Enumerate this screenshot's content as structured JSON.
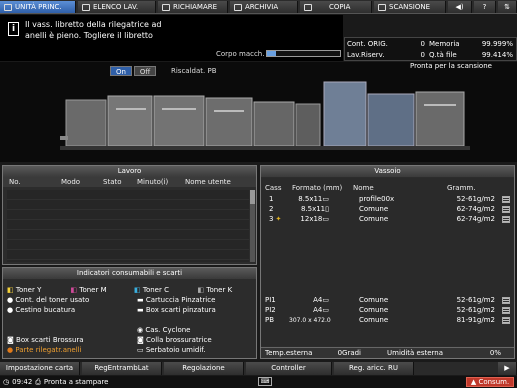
{
  "tabs": [
    {
      "label": "UNITÀ PRINC.",
      "icon": "printer-icon"
    },
    {
      "label": "ELENCO LAV.",
      "icon": "job-list-icon"
    },
    {
      "label": "RICHIAMARE",
      "icon": "recall-icon"
    },
    {
      "label": "ARCHIVIA",
      "icon": "store-icon"
    },
    {
      "label": "COPIA",
      "icon": "copy-icon"
    },
    {
      "label": "SCANSIONE",
      "icon": "scan-icon"
    }
  ],
  "message": {
    "line1": "Il vass. libretto della rilegatrice ad",
    "line2": "anelli è pieno. Togliere il libretto"
  },
  "body_label": "Corpo macch.",
  "counters": {
    "cont_orig_label": "Cont. ORIG.",
    "cont_orig": "0",
    "memoria_label": "Memoria",
    "memoria": "99.999%",
    "lav_riserv_label": "Lav.Riserv.",
    "lav_riserv": "0",
    "qta_file_label": "Q.tà file",
    "qta_file": "99.414%"
  },
  "toggle": {
    "on": "On",
    "off": "Off",
    "label": "Riscaldat. PB"
  },
  "ready_text": "Pronta per la scansione",
  "lavoro": {
    "title": "Lavoro",
    "headers": [
      "No.",
      "Modo",
      "Stato",
      "Minuto(i)",
      "Nome utente"
    ]
  },
  "vassoio": {
    "title": "Vassoio",
    "headers": [
      "Cass",
      "Formato (mm)",
      "Nome",
      "Gramm."
    ],
    "rows": [
      {
        "cass": "1",
        "formato": "8.5x11▭",
        "nome": "profile00x",
        "gramm": "52-61g/m2"
      },
      {
        "cass": "2",
        "formato": "8.5x11▯",
        "nome": "Comune",
        "gramm": "62-74g/m2"
      },
      {
        "cass": "3",
        "formato": "12x18▭",
        "nome": "Comune",
        "gramm": "62-74g/m2"
      },
      {
        "cass": "PI1",
        "formato": "A4▭",
        "nome": "Comune",
        "gramm": "52-61g/m2"
      },
      {
        "cass": "PI2",
        "formato": "A4▭",
        "nome": "Comune",
        "gramm": "52-61g/m2"
      },
      {
        "cass": "PB",
        "formato": "307.0 x 472.0",
        "nome": "Comune",
        "gramm": "81-91g/m2"
      }
    ],
    "temp_label": "Temp.esterna",
    "temp_value": "0Gradi",
    "umid_label": "Umidità esterna",
    "umid_value": "0%"
  },
  "consumabili": {
    "title": "Indicatori consumabili e scarti",
    "items": [
      "Toner Y",
      "Toner M",
      "Toner C",
      "Toner K",
      "Cont. del toner usato",
      "Cartuccia Pinzatrice",
      "Cestino bucatura",
      "Box scarti pinzatura",
      "Cas. Cyclone",
      "Box scarti Brossura",
      "Colla brossuratrice",
      "Parte rilegatr.anelli",
      "Serbatoio umidif."
    ]
  },
  "bottom_tabs": [
    "Impostazione carta",
    "RegEntrambLat",
    "Regolazione",
    "Controller",
    "Reg. aricc. RU"
  ],
  "status": {
    "time": "09:42",
    "message": "Pronta a stampare",
    "consum": "Consum."
  },
  "colors": {
    "accent": "#2f5fa8",
    "warning": "#e07a1a",
    "error": "#c0392b"
  }
}
